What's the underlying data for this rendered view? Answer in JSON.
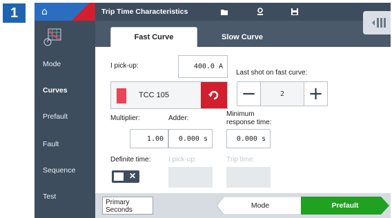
{
  "step_number": "1",
  "colors": {
    "accent_blue": "#2a6dc1",
    "accent_red": "#d11f2d",
    "accent_green": "#21a121",
    "sidebar": "#3e4d5d"
  },
  "header": {
    "title": "Trip Time Characteristics",
    "icons": [
      "folder-icon",
      "user-icon",
      "save-icon"
    ]
  },
  "sidebar": {
    "items": [
      {
        "label": "Mode"
      },
      {
        "label": "Curves",
        "active": true
      },
      {
        "label": "Prefault"
      },
      {
        "label": "Fault"
      },
      {
        "label": "Sequence"
      },
      {
        "label": "Test"
      }
    ]
  },
  "tabs": [
    {
      "label": "Fast Curve",
      "active": true
    },
    {
      "label": "Slow Curve",
      "active": false
    }
  ],
  "form": {
    "ipickup_label": "I pick-up:",
    "ipickup_value": "400.0 A",
    "last_shot_label": "Last shot on fast curve:",
    "curve_name": "TCC 105",
    "last_shot_value": "2",
    "multiplier_label": "Multiplier:",
    "multiplier_value": "1.00",
    "adder_label": "Adder:",
    "adder_value": "0.000 s",
    "min_response_label_line1": "Minimum",
    "min_response_label_line2": "response time:",
    "min_response_value": "0.000 s",
    "definite_time_label": "Definite time:",
    "dt_ipickup_label": "I pick-up:",
    "dt_trip_time_label": "Trip time:"
  },
  "footer": {
    "units_line1": "Primary",
    "units_line2": "Seconds",
    "mode_label": "Mode",
    "prefault_label": "Prefault"
  }
}
